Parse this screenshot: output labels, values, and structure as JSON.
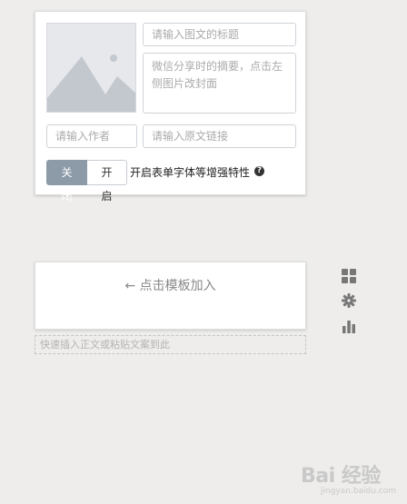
{
  "card": {
    "title_placeholder": "请输入图文的标题",
    "digest_placeholder": "微信分享时的摘要，点击左侧图片改封面",
    "author_placeholder": "请输入作者",
    "link_placeholder": "请输入原文链接",
    "toggle_off_label": "关闭",
    "toggle_on_label": "开启",
    "toggle_selected": "关闭",
    "enhance_label": "开启表单字体等增强特性",
    "help_icon": "question-circle-icon"
  },
  "template": {
    "add_text": "← 点击模板加入"
  },
  "paste": {
    "placeholder": "快速插入正文或粘贴文案到此"
  },
  "side_icons": [
    "grid-icon",
    "gear-icon",
    "bar-chart-icon"
  ],
  "watermark": {
    "text": "Bai 经验",
    "sub": "jingyan.baidu.com"
  },
  "colors": {
    "toggle_active": "#8d9aa8",
    "background": "#eeedeb",
    "placeholder_image": "#e6e8ec"
  }
}
